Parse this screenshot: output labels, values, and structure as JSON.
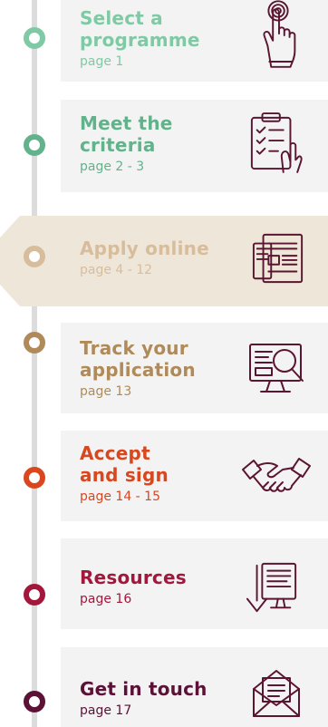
{
  "colors": {
    "rail": "#dcdcdc",
    "icon_stroke": "#5a1530",
    "active_background": "#efe6da"
  },
  "steps": [
    {
      "title": "Select a programme",
      "page": "page 1",
      "color": "#7fc9a4",
      "icon": "touch-hand-icon"
    },
    {
      "title": "Meet the criteria",
      "page": "page 2 - 3",
      "color": "#62b38c",
      "icon": "checklist-clipboard-icon"
    },
    {
      "title": "Apply online",
      "page": "page 4 - 12",
      "color": "#d7bd9c",
      "icon": "online-form-icon",
      "active": true
    },
    {
      "title": "Track your application",
      "page": "page 13",
      "color": "#b08a58",
      "icon": "monitor-search-icon"
    },
    {
      "title": "Accept and sign",
      "page": "page 14 - 15",
      "color": "#d9471f",
      "icon": "handshake-icon"
    },
    {
      "title": "Resources",
      "page": "page 16",
      "color": "#a3173d",
      "icon": "download-computer-icon"
    },
    {
      "title": "Get in touch",
      "page": "page 17",
      "color": "#5b1236",
      "icon": "envelope-icon"
    }
  ]
}
